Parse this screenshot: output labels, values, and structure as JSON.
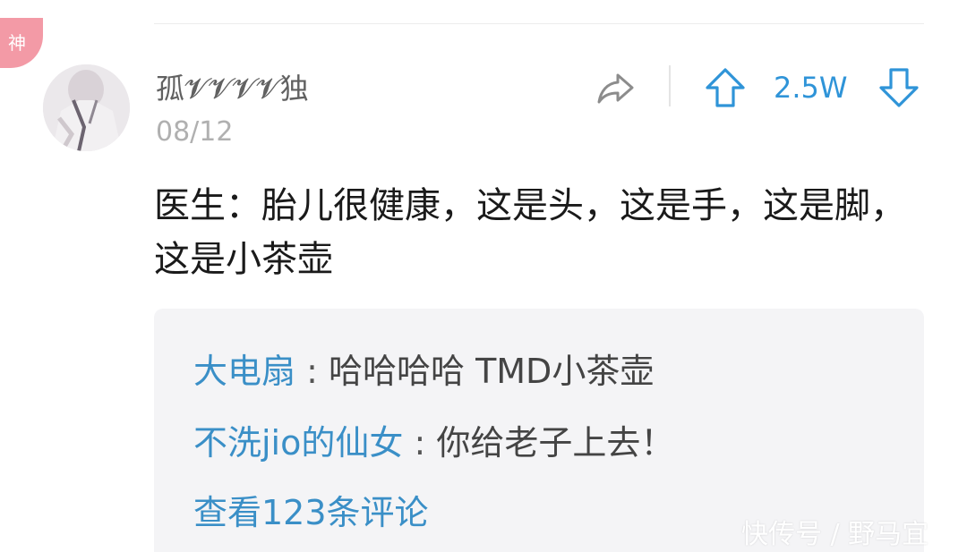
{
  "badge": {
    "label": "神",
    "color": "#f39aa6"
  },
  "post": {
    "username": "孤𝓥𝓥𝓥𝓥独",
    "date": "08/12",
    "vote_count": "2.5W",
    "text": "医生：胎儿很健康，这是头，这是手，这是脚，这是小茶壶"
  },
  "actions": {
    "share_icon": "share-arrow-icon",
    "upvote_icon": "arrow-up-icon",
    "downvote_icon": "arrow-down-icon",
    "accent_color": "#2f94d8"
  },
  "comments": [
    {
      "author": "大电扇",
      "separator": " : ",
      "text": "哈哈哈哈 TMD小茶壶"
    },
    {
      "author": "不洗jio的仙女",
      "separator": " : ",
      "text": "你给老子上去！"
    }
  ],
  "view_more": "查看123条评论",
  "watermark": "快传号 / 野马宜"
}
